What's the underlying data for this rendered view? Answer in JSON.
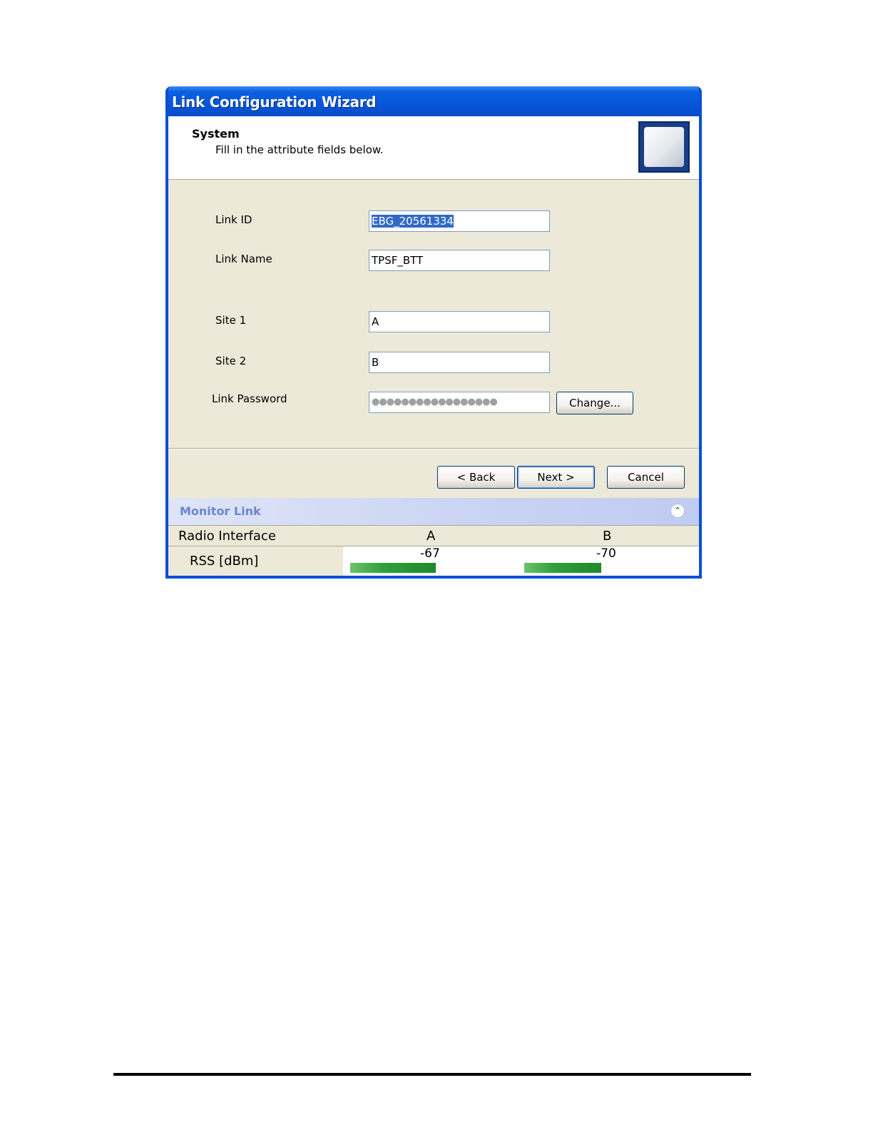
{
  "window": {
    "title": "Link Configuration Wizard"
  },
  "header": {
    "title": "System",
    "subtitle": "Fill in the attribute fields below.",
    "icon": "device-icon"
  },
  "form": {
    "link_id": {
      "label": "Link ID",
      "value": "EBG_20561334"
    },
    "link_name": {
      "label": "Link Name",
      "value": "TPSF_BTT"
    },
    "site1": {
      "label": "Site 1",
      "value": "A"
    },
    "site2": {
      "label": "Site 2",
      "value": "B"
    },
    "password": {
      "label": "Link Password",
      "value": "●●●●●●●●●●●●●●●●●",
      "change_label": "Change..."
    }
  },
  "buttons": {
    "back": "< Back",
    "next": "Next >",
    "cancel": "Cancel"
  },
  "monitor": {
    "title": "Monitor Link",
    "collapse_icon": "double-chevron-up-icon",
    "header_label": "Radio Interface",
    "col_a": "A",
    "col_b": "B",
    "row_label": "RSS [dBm]",
    "rss_a": "-67",
    "rss_b": "-70",
    "bar_color": "#2e9e3a"
  }
}
